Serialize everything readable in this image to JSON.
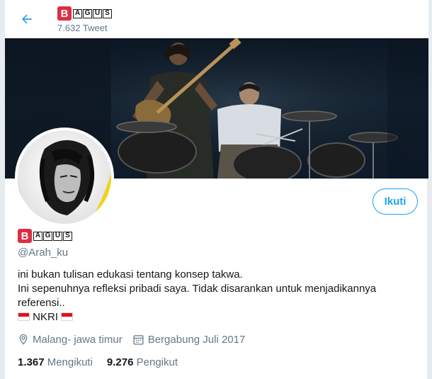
{
  "header": {
    "back_icon": "arrow-left-icon",
    "name_logo": {
      "big": "B",
      "letters": [
        "A",
        "G",
        "U",
        "S"
      ]
    },
    "tweet_count": "7.632 Tweet"
  },
  "profile": {
    "name_logo": {
      "big": "B",
      "letters": [
        "A",
        "G",
        "U",
        "S"
      ]
    },
    "handle": "@Arah_ku",
    "follow_label": "Ikuti",
    "bio": {
      "line1": "ini bukan tulisan edukasi tentang konsep takwa.",
      "line2": "Ini sepenuhnya refleksi pribadi saya. Tidak disarankan untuk menjadikannya",
      "line3": "referensi..",
      "line4_text": "NKRI"
    },
    "location": "Malang- jawa timur",
    "joined": "Bergabung Juli 2017",
    "following_count": "1.367",
    "following_label": "Mengikuti",
    "followers_count": "9.276",
    "followers_label": "Pengikut"
  },
  "colors": {
    "accent": "#1da1f2",
    "secondary_text": "#657786",
    "logo_red": "#dd2e44"
  }
}
